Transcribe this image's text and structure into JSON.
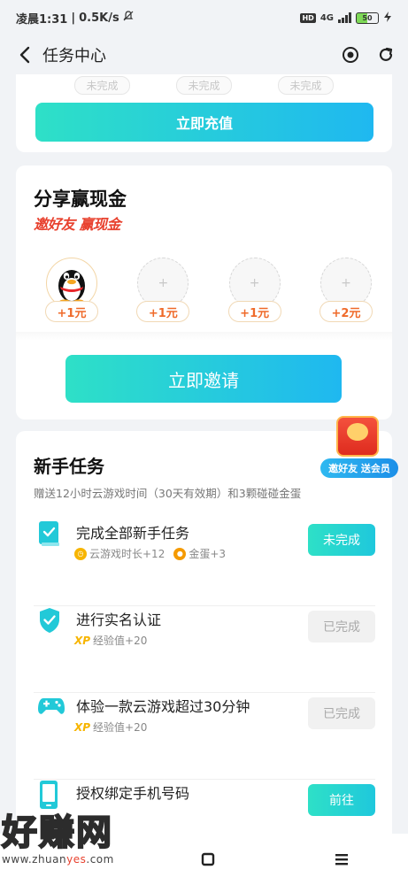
{
  "status_bar": {
    "time": "凌晨1:31",
    "speed": "0.5K/s",
    "hd": "HD",
    "network": "4G",
    "battery": "50"
  },
  "header": {
    "title": "任务中心"
  },
  "recharge_card": {
    "pill_labels": [
      "未完成",
      "未完成",
      "未完成"
    ],
    "button_label": "立即充值"
  },
  "share_card": {
    "title": "分享赢现金",
    "slogan": "邀好友 赢现金",
    "slots": [
      {
        "reward": "+1元",
        "filled": true,
        "icon": "qq-penguin-avatar"
      },
      {
        "reward": "+1元",
        "filled": false,
        "placeholder": "+"
      },
      {
        "reward": "+1元",
        "filled": false,
        "placeholder": "+"
      },
      {
        "reward": "+2元",
        "filled": false,
        "placeholder": "+"
      }
    ],
    "invite_button": "立即邀请"
  },
  "promo_float": {
    "label": "邀好友 送会员"
  },
  "newbie_card": {
    "title": "新手任务",
    "subtitle": "赠送12小时云游戏时间（30天有效期）和3颗碰碰金蛋",
    "tasks": [
      {
        "name": "完成全部新手任务",
        "icon": "book-check-icon",
        "rewards": [
          {
            "icon": "clock-coin",
            "text": "云游戏时长+12"
          },
          {
            "icon": "gold-egg",
            "text": "金蛋+3"
          }
        ],
        "button": "未完成",
        "status": "todo"
      },
      {
        "name": "进行实名认证",
        "icon": "shield-check-icon",
        "rewards": [
          {
            "icon": "xp",
            "badge": "XP",
            "text": "经验值+20"
          }
        ],
        "button": "已完成",
        "status": "done"
      },
      {
        "name": "体验一款云游戏超过30分钟",
        "icon": "gamepad-icon",
        "rewards": [
          {
            "icon": "xp",
            "badge": "XP",
            "text": "经验值+20"
          }
        ],
        "button": "已完成",
        "status": "done"
      },
      {
        "name": "授权绑定手机号码",
        "icon": "phone-icon",
        "rewards": [],
        "button": "前往",
        "status": "todo"
      }
    ]
  },
  "watermark": {
    "main": "好赚网",
    "sub_prefix": "www.zhuan",
    "sub_highlight": "yes",
    "sub_suffix": ".com"
  },
  "colors": {
    "accent_start": "#2ee0c7",
    "accent_end": "#1fb8f0",
    "reward_orange": "#ef6a2a",
    "slogan_red": "#e8422f"
  }
}
